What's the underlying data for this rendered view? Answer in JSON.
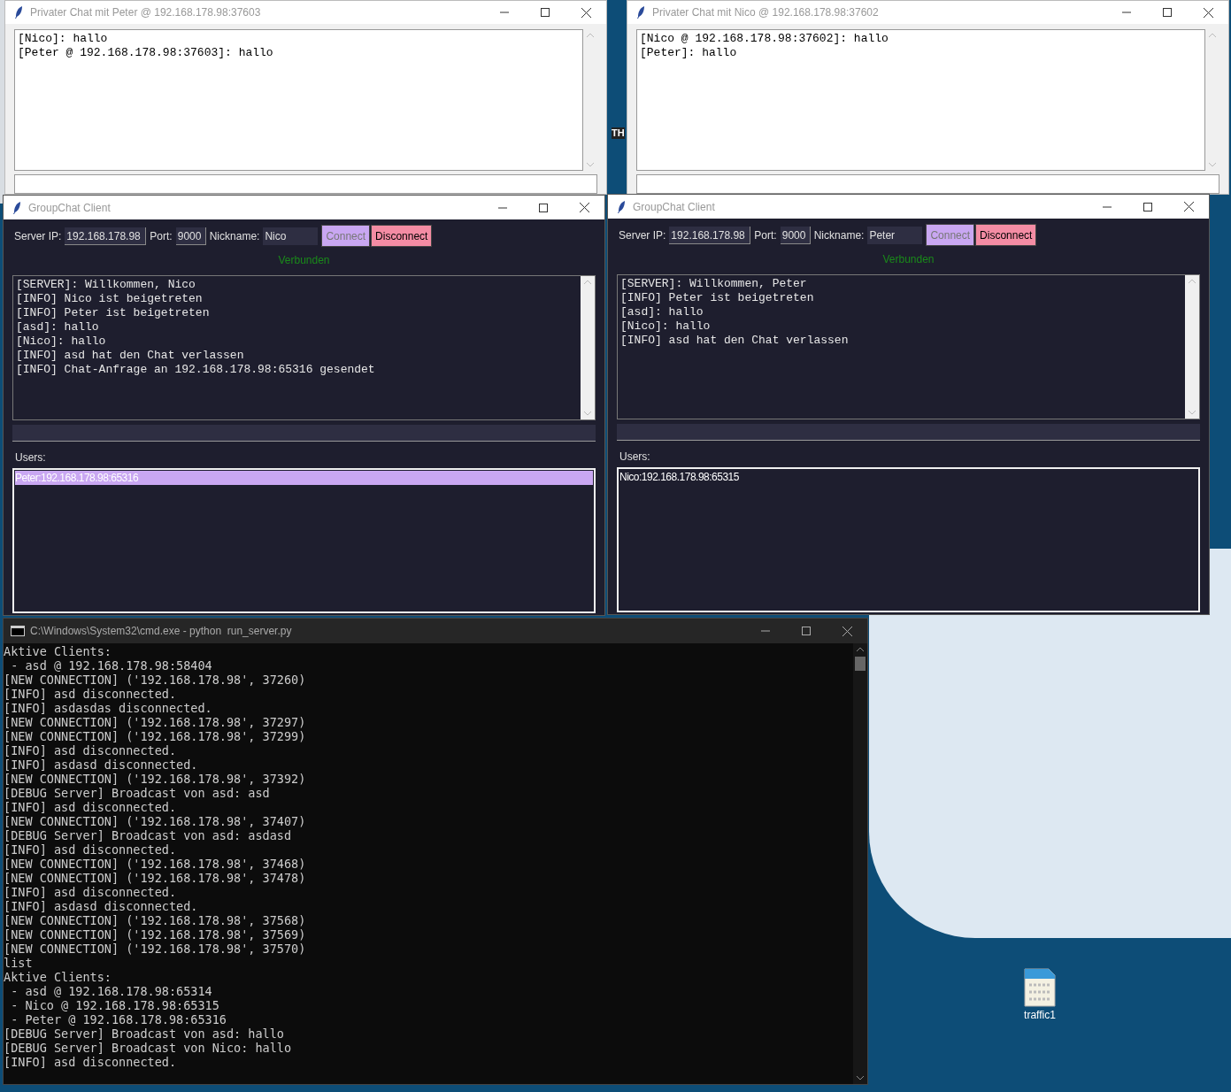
{
  "desktop_fragment": "TH",
  "private_chats": [
    {
      "title": "Privater Chat mit Peter @ 192.168.178.98:37603",
      "messages": [
        "[Nico]: hallo",
        "[Peter @ 192.168.178.98:37603]: hallo"
      ]
    },
    {
      "title": "Privater Chat mit Nico @ 192.168.178.98:37602",
      "messages": [
        "[Nico @ 192.168.178.98:37602]: hallo",
        "[Peter]: hallo"
      ]
    }
  ],
  "group_clients": [
    {
      "title": "GroupChat Client",
      "server_ip_label": "Server IP:",
      "server_ip": "192.168.178.98",
      "port_label": "Port:",
      "port": "9000",
      "nickname_label": "Nickname:",
      "nickname": "Nico",
      "connect": {
        "label": "Connect",
        "disabled": true
      },
      "disconnect": {
        "label": "Disconnect",
        "disabled": false
      },
      "status": "Verbunden",
      "log": [
        "[SERVER]: Willkommen, Nico",
        "[INFO] Nico ist beigetreten",
        "[INFO] Peter ist beigetreten",
        "[asd]: hallo",
        "[Nico]: hallo",
        "[INFO] asd hat den Chat verlassen",
        "[INFO] Chat-Anfrage an 192.168.178.98:65316 gesendet"
      ],
      "users_label": "Users:",
      "users": [
        {
          "label": "Peter:192.168.178.98:65316",
          "selected": true
        }
      ]
    },
    {
      "title": "GroupChat Client",
      "server_ip_label": "Server IP:",
      "server_ip": "192.168.178.98",
      "port_label": "Port:",
      "port": "9000",
      "nickname_label": "Nickname:",
      "nickname": "Peter",
      "connect": {
        "label": "Connect",
        "disabled": true
      },
      "disconnect": {
        "label": "Disconnect",
        "disabled": false
      },
      "status": "Verbunden",
      "log": [
        "[SERVER]: Willkommen, Peter",
        "[INFO] Peter ist beigetreten",
        "[asd]: hallo",
        "[Nico]: hallo",
        "[INFO] asd hat den Chat verlassen"
      ],
      "users_label": "Users:",
      "users": [
        {
          "label": "Nico:192.168.178.98:65315",
          "selected": false
        }
      ]
    }
  ],
  "console": {
    "title": "C:\\Windows\\System32\\cmd.exe - python  run_server.py",
    "lines": [
      "Aktive Clients:",
      " - asd @ 192.168.178.98:58404",
      "[NEW CONNECTION] ('192.168.178.98', 37260)",
      "[INFO] asd disconnected.",
      "[INFO] asdasdas disconnected.",
      "[NEW CONNECTION] ('192.168.178.98', 37297)",
      "[NEW CONNECTION] ('192.168.178.98', 37299)",
      "[INFO] asd disconnected.",
      "[INFO] asdasd disconnected.",
      "[NEW CONNECTION] ('192.168.178.98', 37392)",
      "[DEBUG Server] Broadcast von asd: asd",
      "[INFO] asd disconnected.",
      "[NEW CONNECTION] ('192.168.178.98', 37407)",
      "[DEBUG Server] Broadcast von asd: asdasd",
      "[INFO] asd disconnected.",
      "[NEW CONNECTION] ('192.168.178.98', 37468)",
      "[NEW CONNECTION] ('192.168.178.98', 37478)",
      "[INFO] asd disconnected.",
      "[INFO] asdasd disconnected.",
      "[NEW CONNECTION] ('192.168.178.98', 37568)",
      "[NEW CONNECTION] ('192.168.178.98', 37569)",
      "[NEW CONNECTION] ('192.168.178.98', 37570)",
      "list",
      "Aktive Clients:",
      " - asd @ 192.168.178.98:65314",
      " - Nico @ 192.168.178.98:65315",
      " - Peter @ 192.168.178.98:65316",
      "[DEBUG Server] Broadcast von asd: hallo",
      "[DEBUG Server] Broadcast von Nico: hallo",
      "[INFO] asd disconnected."
    ]
  },
  "desktop_icon": {
    "label": "traffic1"
  }
}
